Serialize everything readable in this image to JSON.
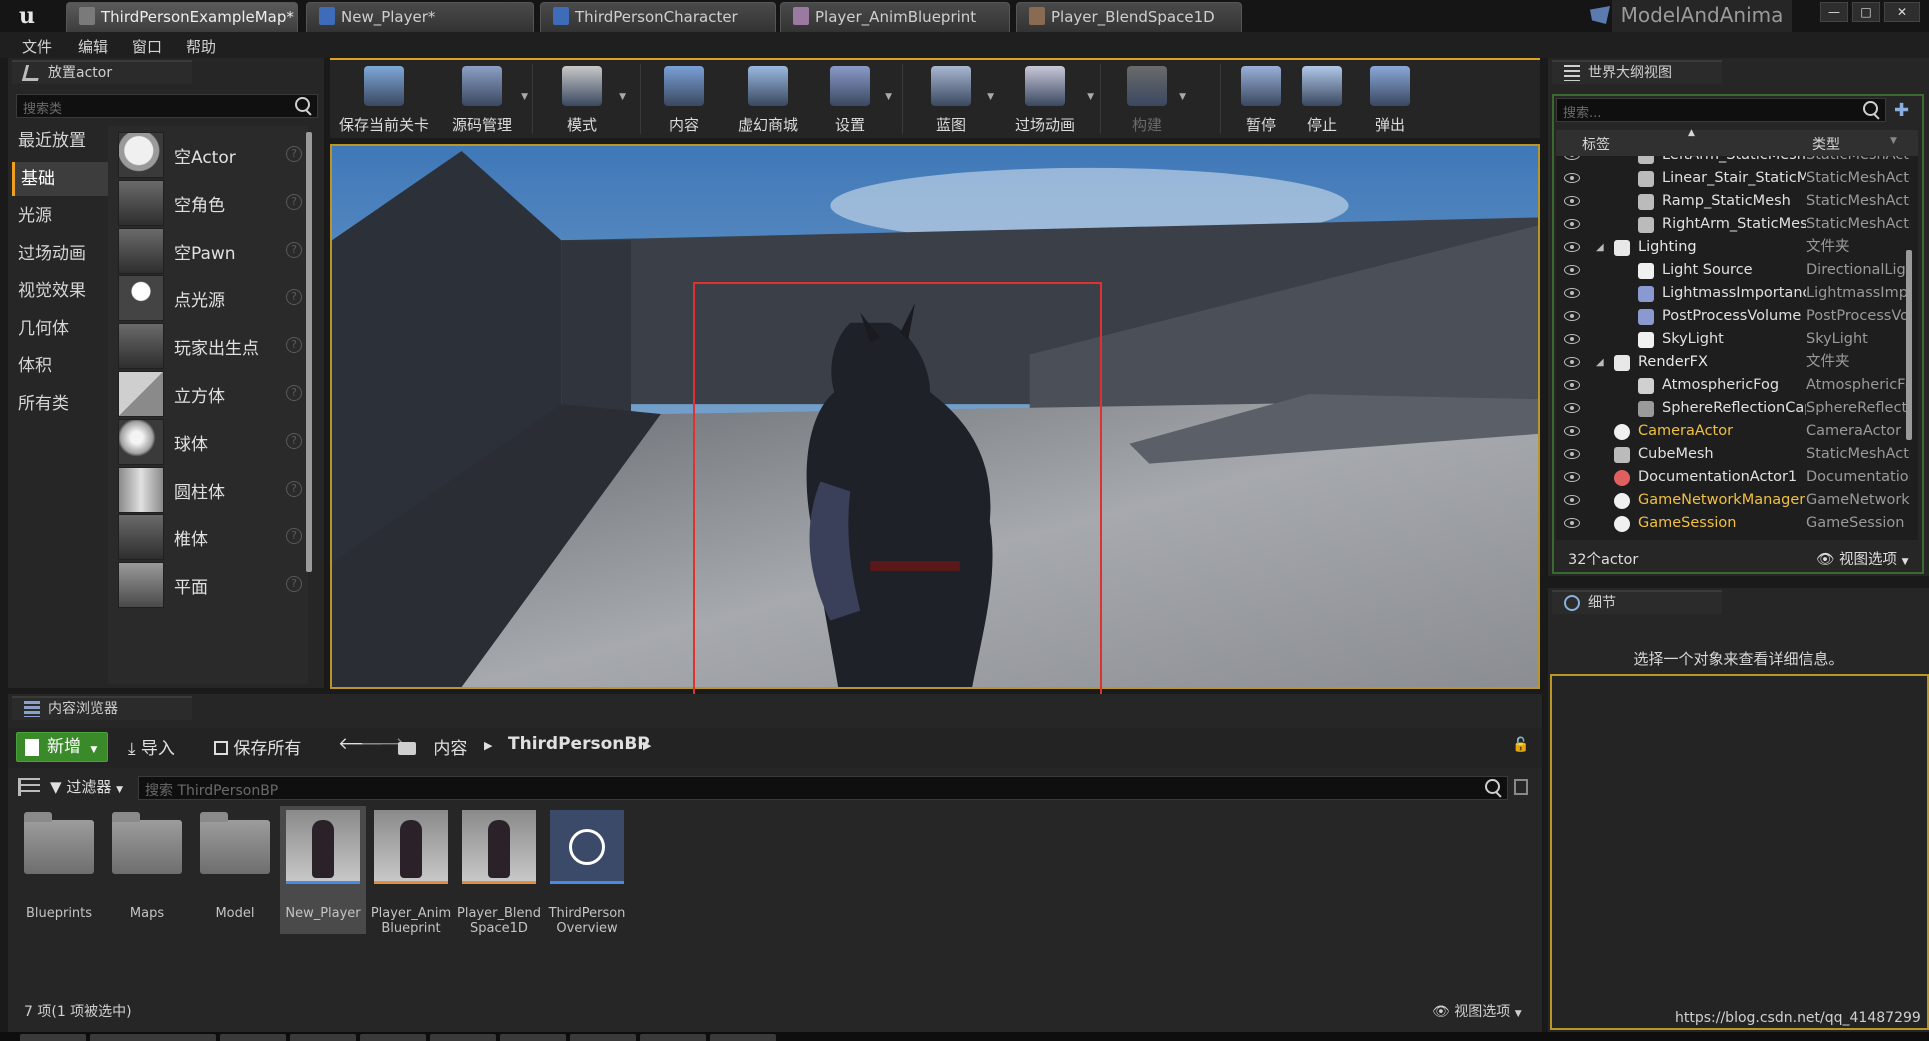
{
  "tabs": [
    {
      "label": "ThirdPersonExampleMap*",
      "icon": "map-icon",
      "active": true
    },
    {
      "label": "New_Player*",
      "icon": "blueprint-icon"
    },
    {
      "label": "ThirdPersonCharacter",
      "icon": "blueprint-icon"
    },
    {
      "label": "Player_AnimBlueprint",
      "icon": "anim-blueprint-icon"
    },
    {
      "label": "Player_BlendSpace1D",
      "icon": "blendspace-icon"
    }
  ],
  "project_name": "ModelAndAnima",
  "menu": [
    "文件",
    "编辑",
    "窗口",
    "帮助"
  ],
  "place_actors": {
    "title": "放置actor",
    "search_placeholder": "搜索类",
    "categories": [
      "最近放置",
      "基础",
      "光源",
      "过场动画",
      "视觉效果",
      "几何体",
      "体积",
      "所有类"
    ],
    "active_category": "基础",
    "items": [
      "空Actor",
      "空角色",
      "空Pawn",
      "点光源",
      "玩家出生点",
      "立方体",
      "球体",
      "圆柱体",
      "椎体",
      "平面"
    ]
  },
  "toolbar": [
    {
      "label": "保存当前关卡",
      "icon": "save-icon"
    },
    {
      "label": "源码管理",
      "icon": "source-control-icon"
    },
    {
      "label": "模式",
      "icon": "modes-icon"
    },
    {
      "label": "内容",
      "icon": "content-icon"
    },
    {
      "label": "虚幻商城",
      "icon": "marketplace-icon"
    },
    {
      "label": "设置",
      "icon": "settings-icon"
    },
    {
      "label": "蓝图",
      "icon": "blueprints-icon"
    },
    {
      "label": "过场动画",
      "icon": "cinematics-icon"
    },
    {
      "label": "构建",
      "icon": "build-icon",
      "disabled": true
    },
    {
      "label": "暂停",
      "icon": "pause-icon"
    },
    {
      "label": "停止",
      "icon": "stop-icon"
    },
    {
      "label": "弹出",
      "icon": "eject-icon"
    }
  ],
  "content_browser": {
    "title": "内容浏览器",
    "new_label": "新增",
    "import_label": "导入",
    "save_all_label": "保存所有",
    "path_root": "内容",
    "path_folder": "ThirdPersonBP",
    "filter_label": "过滤器",
    "search_placeholder": "搜索 ThirdPersonBP",
    "assets": [
      {
        "name": "Blueprints",
        "kind": "folder"
      },
      {
        "name": "Maps",
        "kind": "folder"
      },
      {
        "name": "Model",
        "kind": "folder"
      },
      {
        "name": "New_Player",
        "kind": "character",
        "selected": true
      },
      {
        "name": "Player_Anim\nBlueprint",
        "kind": "character"
      },
      {
        "name": "Player_Blend\nSpace1D",
        "kind": "character"
      },
      {
        "name": "ThirdPerson\nOverview",
        "kind": "overview"
      }
    ],
    "status": "7 项(1 项被选中)",
    "view_options": "视图选项"
  },
  "world_outliner": {
    "title": "世界大纲视图",
    "search_placeholder": "搜索...",
    "col_label": "标签",
    "col_type": "类型",
    "rows": [
      {
        "label": "LeftArm_StaticMesh",
        "type": "StaticMeshActor",
        "kind": "mesh",
        "indent": 2
      },
      {
        "label": "Linear_Stair_StaticMesh",
        "type": "StaticMeshActor",
        "kind": "mesh",
        "indent": 2
      },
      {
        "label": "Ramp_StaticMesh",
        "type": "StaticMeshActor",
        "kind": "mesh",
        "indent": 2
      },
      {
        "label": "RightArm_StaticMesh",
        "type": "StaticMeshActor",
        "kind": "mesh",
        "indent": 2
      },
      {
        "label": "Lighting",
        "type": "文件夹",
        "kind": "folder",
        "indent": 1
      },
      {
        "label": "Light Source",
        "type": "DirectionalLight",
        "kind": "light",
        "indent": 2
      },
      {
        "label": "LightmassImportanceVolume",
        "type": "LightmassImportanceVolume",
        "kind": "volume",
        "indent": 2
      },
      {
        "label": "PostProcessVolume",
        "type": "PostProcessVolume",
        "kind": "volume",
        "indent": 2
      },
      {
        "label": "SkyLight",
        "type": "SkyLight",
        "kind": "light",
        "indent": 2
      },
      {
        "label": "RenderFX",
        "type": "文件夹",
        "kind": "folder",
        "indent": 1
      },
      {
        "label": "AtmosphericFog",
        "type": "AtmosphericFog",
        "kind": "fog",
        "indent": 2
      },
      {
        "label": "SphereReflectionCapture",
        "type": "SphereReflectionCapture",
        "kind": "sphere",
        "indent": 2
      },
      {
        "label": "CameraActor",
        "type": "CameraActor",
        "kind": "bp",
        "indent": 1
      },
      {
        "label": "CubeMesh",
        "type": "StaticMeshActor",
        "kind": "mesh",
        "indent": 1
      },
      {
        "label": "DocumentationActor1",
        "type": "DocumentationActor",
        "kind": "doc",
        "indent": 1
      },
      {
        "label": "GameNetworkManager",
        "type": "GameNetworkManager",
        "kind": "bp",
        "indent": 1
      },
      {
        "label": "GameSession",
        "type": "GameSession",
        "kind": "bp",
        "indent": 1
      }
    ],
    "actor_count": "32个actor",
    "view_options": "视图选项"
  },
  "details": {
    "title": "细节",
    "empty_message": "选择一个对象来查看详细信息。"
  },
  "watermark": "https://blog.csdn.net/qq_41487299",
  "colors": {
    "accent": "#e0a020",
    "selection_box": "#e03030",
    "new_button": "#3a8a2a",
    "blueprint_label": "#f0c040"
  }
}
